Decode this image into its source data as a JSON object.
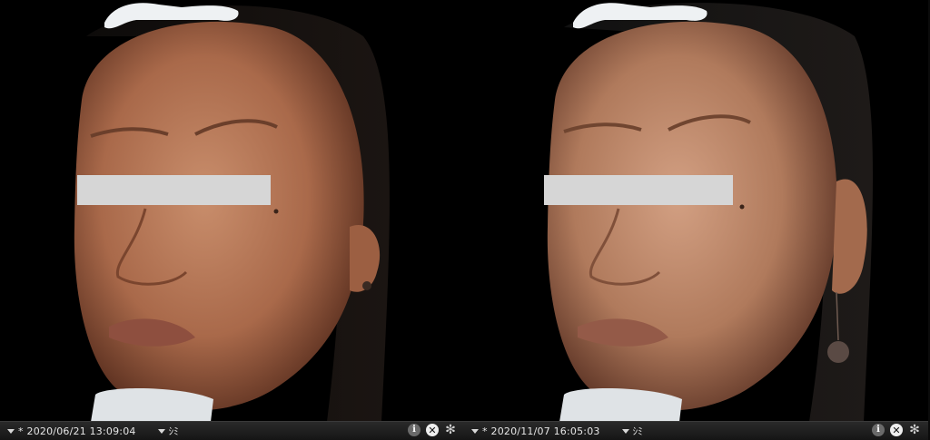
{
  "panes": [
    {
      "star": "*",
      "datetime": "2020/06/21 13:09:04",
      "tag_label": "ｼﾐ",
      "icons": [
        "info-icon",
        "close-icon",
        "gear-icon"
      ]
    },
    {
      "star": "*",
      "datetime": "2020/11/07 16:05:03",
      "tag_label": "ｼﾐ",
      "icons": [
        "info-icon",
        "close-icon",
        "gear-icon"
      ]
    }
  ],
  "icon_glyphs": {
    "info": "i",
    "close": "✕",
    "gear": "✻"
  },
  "colors": {
    "censor_bar": "#d6d6d6",
    "statusbar_bg": "#1f1f1f",
    "text": "#e6e6e6"
  }
}
